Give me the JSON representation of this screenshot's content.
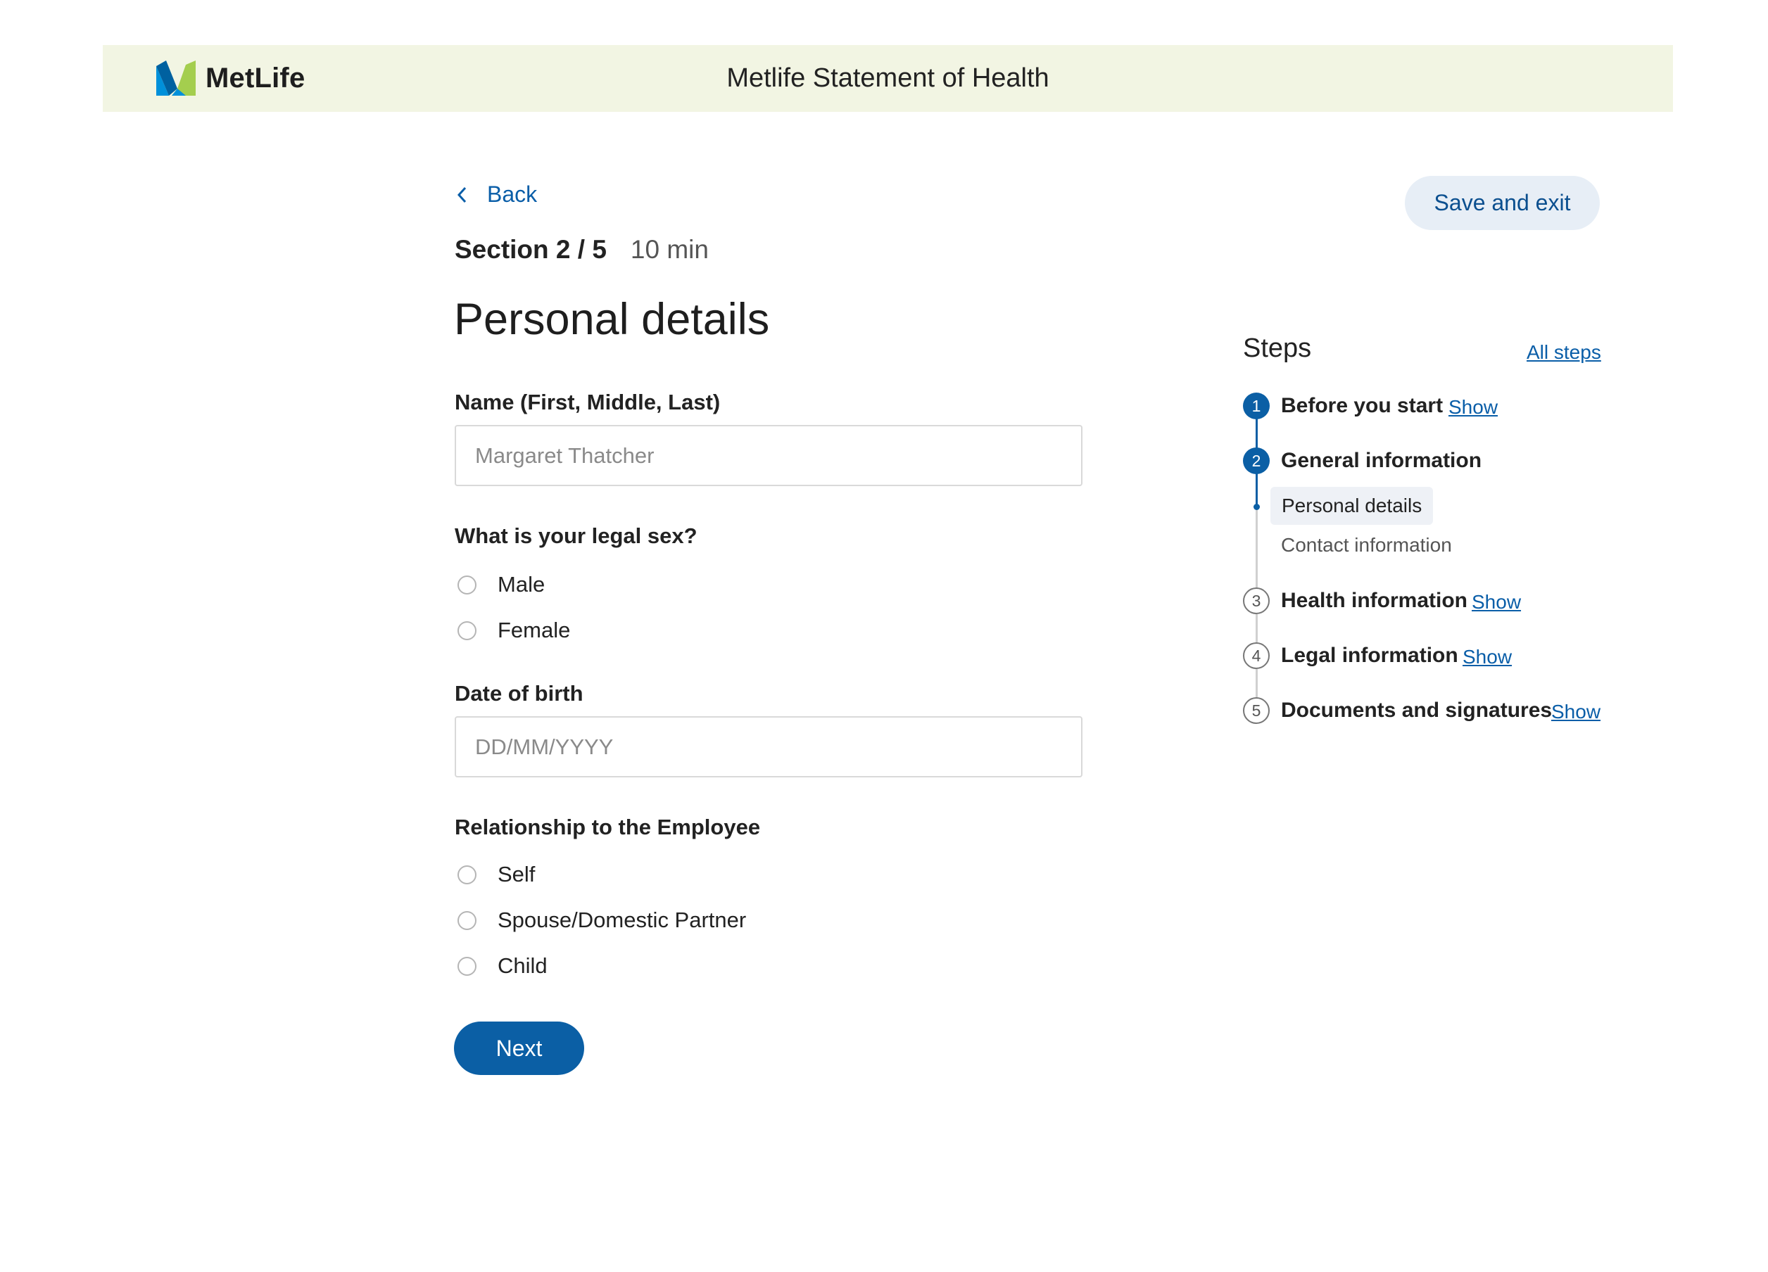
{
  "header": {
    "brand": "MetLife",
    "title": "Metlife Statement of Health"
  },
  "nav": {
    "back_label": "Back",
    "save_exit_label": "Save and exit"
  },
  "section": {
    "label": "Section 2 / 5",
    "time": "10 min"
  },
  "page_title": "Personal details",
  "form": {
    "name": {
      "label": "Name (First, Middle, Last)",
      "placeholder": "Margaret Thatcher",
      "value": ""
    },
    "sex": {
      "label": "What is your legal sex?",
      "options": [
        "Male",
        "Female"
      ]
    },
    "dob": {
      "label": "Date of birth",
      "placeholder": "DD/MM/YYYY",
      "value": ""
    },
    "relationship": {
      "label": "Relationship to the Employee",
      "options": [
        "Self",
        "Spouse/Domestic Partner",
        "Child"
      ]
    },
    "next_label": "Next"
  },
  "steps": {
    "title": "Steps",
    "all_steps_label": "All steps",
    "show_label": "Show",
    "items": [
      {
        "number": "1",
        "label": "Before you start"
      },
      {
        "number": "2",
        "label": "General information",
        "substeps": [
          "Personal details",
          "Contact information"
        ]
      },
      {
        "number": "3",
        "label": "Health information"
      },
      {
        "number": "4",
        "label": "Legal information"
      },
      {
        "number": "5",
        "label": "Documents and signatures"
      }
    ]
  },
  "colors": {
    "brand_blue": "#0b5fa5",
    "header_bg": "#f2f5e3",
    "link": "#0a5ea8",
    "logo_blue": "#0090da",
    "logo_green": "#a4ce4e",
    "logo_dark_blue": "#0061a0"
  }
}
